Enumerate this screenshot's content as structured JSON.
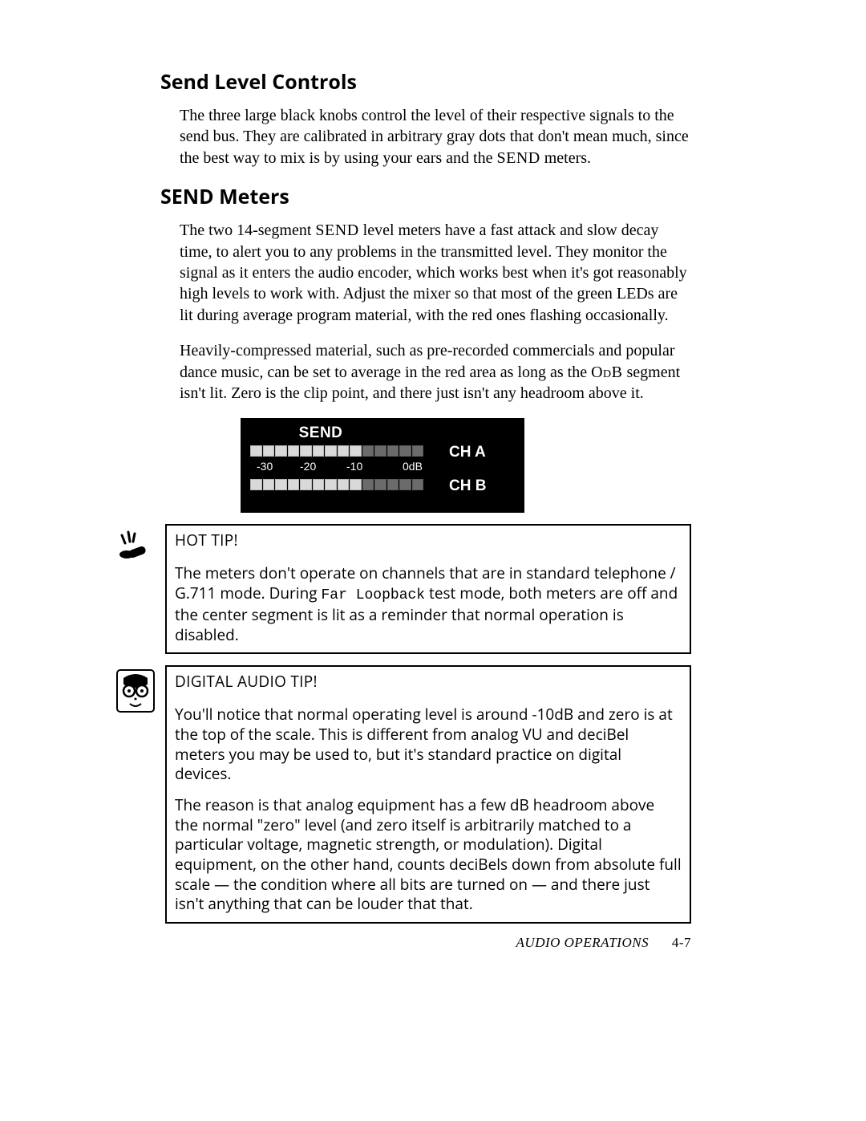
{
  "sections": {
    "sendLevel": {
      "heading": "Send Level Controls",
      "p1_a": "The three large black knobs control the level of their respective signals to the send bus. They are calibrated in arbitrary gray dots that don't mean much, since the best way to mix is by using your ears and the ",
      "p1_sc": "SEND",
      "p1_b": " meters."
    },
    "sendMeters": {
      "heading": "SEND Meters",
      "p1_a": "The two 14-segment ",
      "p1_sc": "SEND",
      "p1_b": " level meters have a fast attack and slow decay time, to alert you to any problems in the transmitted level. They monitor the signal as it enters the audio encoder, which works best when it's got reasonably high levels to work with. Adjust the mixer so that most of the green LEDs are lit during average program material, with the red ones flashing occasionally.",
      "p2_a": "Heavily-compressed material, such as pre-recorded commercials and popular dance music, can be set to average in the red area as long as the ",
      "p2_sc": "OdB",
      "p2_b": " segment isn't lit. Zero is the clip point, and there just isn't any headroom above it."
    }
  },
  "meter": {
    "title": "SEND",
    "chA": "CH A",
    "chB": "CH B",
    "scale": {
      "m30": "-30",
      "m20": "-20",
      "m10": "-10",
      "zero": "0dB"
    }
  },
  "hotTip": {
    "title": "HOT TIP!",
    "p1_a": "The meters don't operate on channels that are in standard telephone / G.711 mode. During ",
    "p1_mono": "Far Loopback",
    "p1_b": " test mode, both meters are off and the center segment is lit as a reminder that normal operation is disabled."
  },
  "digitalTip": {
    "title": "DIGITAL AUDIO TIP!",
    "p1": "You'll notice that normal operating level is around -10dB and zero is at the top of the scale. This is different from analog VU and deciBel meters you may be used to, but it's standard practice on digital devices.",
    "p2": "The reason is that analog equipment has a few dB headroom above the normal \"zero\" level (and zero itself is arbitrarily matched to a particular voltage, magnetic strength, or modulation). Digital equipment, on the other hand, counts deciBels down from absolute full scale — the condition where all bits are turned on — and there just isn't anything that can be louder that that."
  },
  "footer": {
    "label": "AUDIO OPERATIONS",
    "page": "4-7"
  }
}
